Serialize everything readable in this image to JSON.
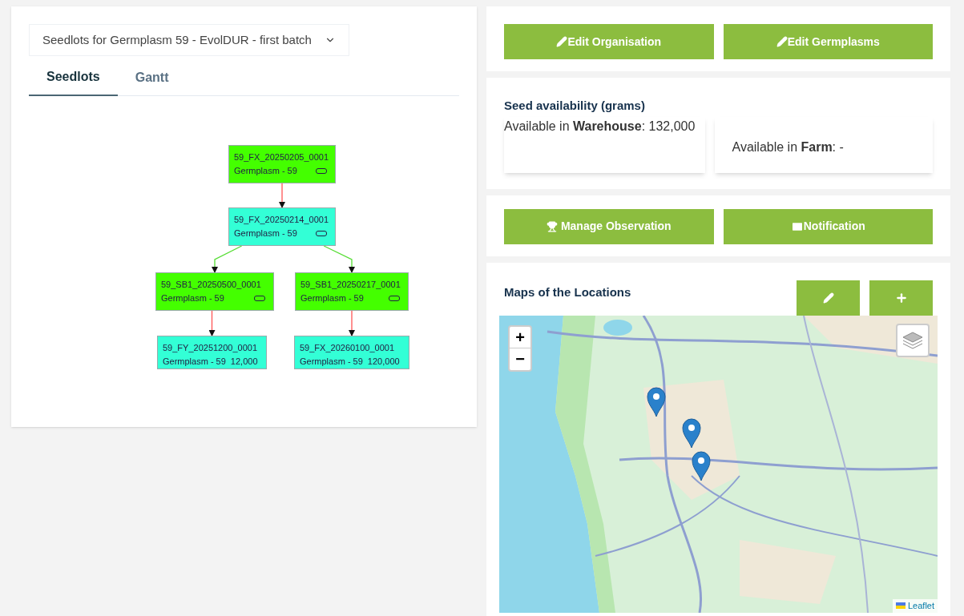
{
  "left_panel": {
    "dropdown": {
      "value": "Seedlots for Germplasm 59 - EvolDUR - first batch"
    },
    "tabs": [
      {
        "label": "Seedlots",
        "selected": true
      },
      {
        "label": "Gantt",
        "selected": false
      }
    ],
    "diagram": {
      "nodes": [
        {
          "name": "59_FX_20250205_0001",
          "germplasm": "Germplasm - 59",
          "badge": true,
          "color": "#44ff00"
        },
        {
          "name": "59_FX_20250214_0001",
          "germplasm": "Germplasm - 59",
          "badge": true,
          "color": "#33ffd6"
        },
        {
          "name": "59_SB1_20250500_0001",
          "germplasm": "Germplasm - 59",
          "badge": true,
          "color": "#44ff00"
        },
        {
          "name": "59_SB1_20250217_0001",
          "germplasm": "Germplasm - 59",
          "badge": true,
          "color": "#44ff00"
        },
        {
          "name": "59_FY_20251200_0001",
          "germplasm": "Germplasm - 59",
          "amount": "12,000",
          "badge": false,
          "color": "#33ffd6"
        },
        {
          "name": "59_FX_20260100_0001",
          "germplasm": "Germplasm - 59",
          "amount": "120,000",
          "badge": false,
          "color": "#33ffd6"
        }
      ],
      "edges": [
        {
          "color": "#ff5555"
        },
        {
          "color": "#55dd33"
        },
        {
          "color": "#55dd33"
        },
        {
          "color": "#ff5555"
        },
        {
          "color": "#ff5555"
        }
      ]
    }
  },
  "right_panel": {
    "top_buttons": [
      {
        "label": "Edit Organisation"
      },
      {
        "label": "Edit Germplasms"
      }
    ],
    "availability": {
      "title": "Seed availability (grams)",
      "cards": [
        "Available in **Warehouse**: 132,000",
        "Available in **Farm**: -"
      ]
    },
    "action_buttons": [
      {
        "label": "Manage Observation"
      },
      {
        "label": "Notification"
      }
    ],
    "map_section": {
      "title": "Maps of the Locations",
      "zoom_in": "+",
      "zoom_out": "−",
      "attribution": "Leaflet"
    }
  }
}
